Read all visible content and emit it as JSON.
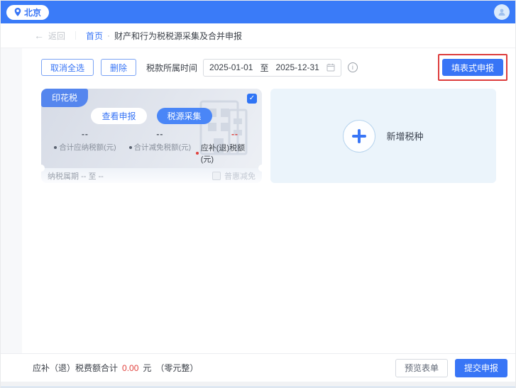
{
  "topbar": {
    "location": "北京"
  },
  "breadcrumb": {
    "back_arrow": "←",
    "back": "返回",
    "home": "首页",
    "dot": "·",
    "title": "财产和行为税税源采集及合并申报"
  },
  "toolbar": {
    "cancel_select_all": "取消全选",
    "delete": "删除",
    "date_label": "税款所属时间",
    "date_start": "2025-01-01",
    "date_to": "至",
    "date_end": "2025-12-31",
    "info_glyph": "i",
    "form_declare": "填表式申报"
  },
  "tax_card": {
    "tag": "印花税",
    "checkbox_mark": "✓",
    "view_declare": "查看申报",
    "source_collect": "税源采集",
    "stats": [
      {
        "value": "--",
        "label": "合计应纳税额(元)"
      },
      {
        "value": "--",
        "label": "合计减免税额(元)"
      },
      {
        "value": "--",
        "label": "应补(退)税额(元)"
      }
    ],
    "period_label": "纳税属期",
    "period_value": "-- 至 --",
    "relief_label": "普惠减免"
  },
  "add_panel": {
    "label": "新增税种"
  },
  "footer": {
    "total_label": "应补（退）税费额合计",
    "total_value": "0.00",
    "unit": "元",
    "amount_words": "（零元整）",
    "preview": "预览表单",
    "submit": "提交申报"
  },
  "colors": {
    "primary_blue": "#3875f6",
    "topbar_blue": "#3a7bf8",
    "annotation_red": "#dd3c3c",
    "negative_red": "#e0403c",
    "add_panel_bg": "#ebf4fb"
  }
}
